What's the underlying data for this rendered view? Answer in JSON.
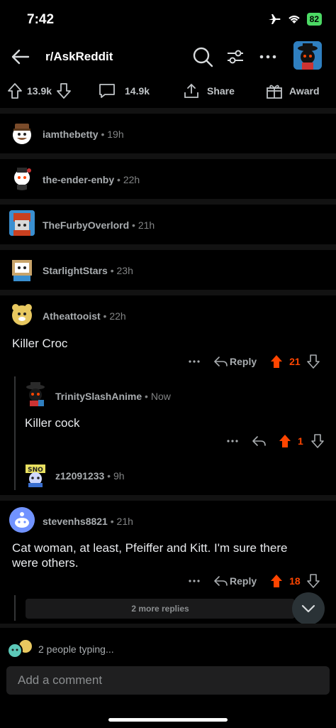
{
  "status_bar": {
    "time": "7:42",
    "battery": "82"
  },
  "header": {
    "title": "r/AskReddit"
  },
  "post_actions": {
    "upvotes": "13.9k",
    "comments": "14.9k",
    "share": "Share",
    "award": "Award"
  },
  "collapsed_comments": [
    {
      "user": "iamthebetty",
      "age": "19h"
    },
    {
      "user": "the-ender-enby",
      "age": "22h"
    },
    {
      "user": "TheFurbyOverlord",
      "age": "21h"
    },
    {
      "user": "StarlightStars",
      "age": "23h"
    }
  ],
  "comment1": {
    "user": "Atheattooist",
    "age": "22h",
    "text": "Killer Croc",
    "reply": "Reply",
    "votes": "21"
  },
  "reply1": {
    "user": "TrinitySlashAnime",
    "age": "Now",
    "text": "Killer cock",
    "votes": "1"
  },
  "reply2": {
    "user": "z12091233",
    "age": "9h"
  },
  "comment2": {
    "user": "stevenhs8821",
    "age": "21h",
    "text_line1": "Cat woman, at least, Pfeiffer and Kitt.  I'm sure there",
    "text_line2": "were others.",
    "reply": "Reply",
    "votes": "18",
    "more_replies": "2 more replies"
  },
  "footer": {
    "typing": "2 people typing...",
    "comment_placeholder": "Add a comment"
  },
  "colors": {
    "upvote": "#ff4500",
    "background": "#000000"
  }
}
